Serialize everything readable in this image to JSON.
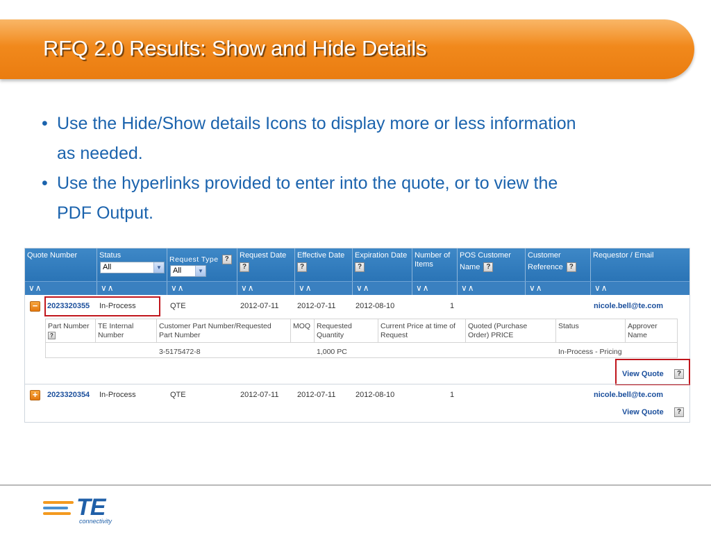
{
  "slide": {
    "title": "RFQ 2.0 Results:  Show and Hide Details",
    "bullets": [
      {
        "line1": "Use the Hide/Show details Icons to display more or less information",
        "line2": "as needed."
      },
      {
        "line1": "Use the hyperlinks provided to enter into the quote, or to view the",
        "line2": "PDF Output."
      }
    ],
    "bullet_symbol": "•"
  },
  "grid": {
    "headers": {
      "quote_number": "Quote Number",
      "status": "Status",
      "status_select": "All",
      "request_type": "Request Type",
      "request_type_select": "All",
      "request_date": "Request Date",
      "effective_date": "Effective Date",
      "expiration_date": "Expiration Date",
      "number_of_items_1": "Number of",
      "number_of_items_2": "Items",
      "pos_customer_1": "POS Customer",
      "pos_customer_2": "Name",
      "customer_ref_1": "Customer",
      "customer_ref_2": "Reference",
      "requestor": "Requestor / Email"
    },
    "help_mark": "?",
    "sort_glyph": "∨∧",
    "select_arrow": "▼",
    "rows": [
      {
        "toggle": "−",
        "quote_number": "2023320355",
        "status": "In-Process",
        "request_type": "QTE",
        "request_date": "2012-07-11",
        "effective_date": "2012-07-11",
        "expiration_date": "2012-08-10",
        "items": "1",
        "email": "nicole.bell@te.com",
        "view_quote": "View Quote"
      },
      {
        "toggle": "+",
        "quote_number": "2023320354",
        "status": "In-Process",
        "request_type": "QTE",
        "request_date": "2012-07-11",
        "effective_date": "2012-07-11",
        "expiration_date": "2012-08-10",
        "items": "1",
        "email": "nicole.bell@te.com",
        "view_quote": "View Quote"
      }
    ],
    "detail": {
      "headers": {
        "part_number": "Part Number",
        "te_internal_1": "TE Internal",
        "te_internal_2": "Number",
        "cust_part_1": "Customer Part Number/Requested",
        "cust_part_2": "Part Number",
        "moq": "MOQ",
        "req_qty_1": "Requested",
        "req_qty_2": "Quantity",
        "current_price_1": "Current Price at time of",
        "current_price_2": "Request",
        "quoted_1": "Quoted (Purchase",
        "quoted_2": "Order) PRICE",
        "status": "Status",
        "approver_1": "Approver",
        "approver_2": "Name"
      },
      "values": {
        "cust_part": "3-5175472-8",
        "req_qty": "1,000 PC",
        "status": "In-Process - Pricing"
      }
    }
  },
  "footer": {
    "logo_text": "TE",
    "logo_sub": "connectivity"
  },
  "colors": {
    "banner": "#f1891c",
    "bullet_text": "#1b63ad",
    "grid_header": "#2a74b6",
    "link": "#1b4f9c",
    "highlight_box": "#c0151c"
  }
}
